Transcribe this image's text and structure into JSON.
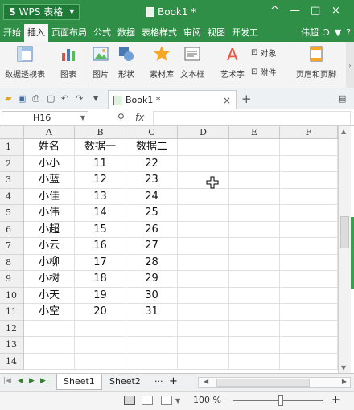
{
  "titlebar": {
    "app_logo": "S",
    "app_name": "WPS 表格",
    "doc_title": "Book1 *",
    "controls": [
      "^",
      "—",
      "□",
      "×"
    ],
    "bg_color": "#2f8f47"
  },
  "menubar": {
    "items": [
      "开始",
      "插入",
      "页面布局",
      "公式",
      "数据",
      "表格样式",
      "审阅",
      "视图",
      "开发工"
    ],
    "active_index": 1,
    "user": "伟超",
    "extras": [
      "?"
    ]
  },
  "ribbon": {
    "buttons": [
      {
        "label": "数据透视表",
        "icon": "pivot-table-icon"
      },
      {
        "label": "图表",
        "icon": "chart-icon"
      },
      {
        "label": "图片",
        "icon": "picture-icon"
      },
      {
        "label": "形状",
        "icon": "shape-icon"
      },
      {
        "label": "素材库",
        "icon": "star-icon"
      },
      {
        "label": "文本框",
        "icon": "textbox-icon"
      },
      {
        "label": "艺术字",
        "icon": "wordart-icon"
      },
      {
        "label": "页眉和页脚",
        "icon": "header-footer-icon"
      }
    ],
    "small_buttons": [
      {
        "label": "对象",
        "icon": "object-icon"
      },
      {
        "label": "附件",
        "icon": "attachment-icon"
      }
    ]
  },
  "tabbar": {
    "doc_tab": "Book1 *"
  },
  "formula_bar": {
    "name_box": "H16",
    "fx_label": "fx",
    "value": ""
  },
  "sheet": {
    "columns": [
      "A",
      "B",
      "C",
      "D",
      "E",
      "F"
    ],
    "rows": [
      {
        "num": "1",
        "cells": [
          "姓名",
          "数据一",
          "数据二",
          "",
          "",
          ""
        ]
      },
      {
        "num": "2",
        "cells": [
          "小小",
          "11",
          "22",
          "",
          "",
          ""
        ]
      },
      {
        "num": "3",
        "cells": [
          "小蓝",
          "12",
          "23",
          "",
          "",
          ""
        ]
      },
      {
        "num": "4",
        "cells": [
          "小佳",
          "13",
          "24",
          "",
          "",
          ""
        ]
      },
      {
        "num": "5",
        "cells": [
          "小伟",
          "14",
          "25",
          "",
          "",
          ""
        ]
      },
      {
        "num": "6",
        "cells": [
          "小超",
          "15",
          "26",
          "",
          "",
          ""
        ]
      },
      {
        "num": "7",
        "cells": [
          "小云",
          "16",
          "27",
          "",
          "",
          ""
        ]
      },
      {
        "num": "8",
        "cells": [
          "小柳",
          "17",
          "28",
          "",
          "",
          ""
        ]
      },
      {
        "num": "9",
        "cells": [
          "小树",
          "18",
          "29",
          "",
          "",
          ""
        ]
      },
      {
        "num": "10",
        "cells": [
          "小天",
          "19",
          "30",
          "",
          "",
          ""
        ]
      },
      {
        "num": "11",
        "cells": [
          "小空",
          "20",
          "31",
          "",
          "",
          ""
        ]
      },
      {
        "num": "12",
        "cells": [
          "",
          "",
          "",
          "",
          "",
          ""
        ]
      },
      {
        "num": "13",
        "cells": [
          "",
          "",
          "",
          "",
          "",
          ""
        ]
      },
      {
        "num": "14",
        "cells": [
          "",
          "",
          "",
          "",
          "",
          ""
        ]
      }
    ]
  },
  "sheet_tabs": {
    "tabs": [
      "Sheet1",
      "Sheet2"
    ],
    "active_index": 0,
    "more": "···",
    "add": "+"
  },
  "statusbar": {
    "zoom": "100 %",
    "zoom_minus": "—",
    "zoom_plus": "+"
  }
}
